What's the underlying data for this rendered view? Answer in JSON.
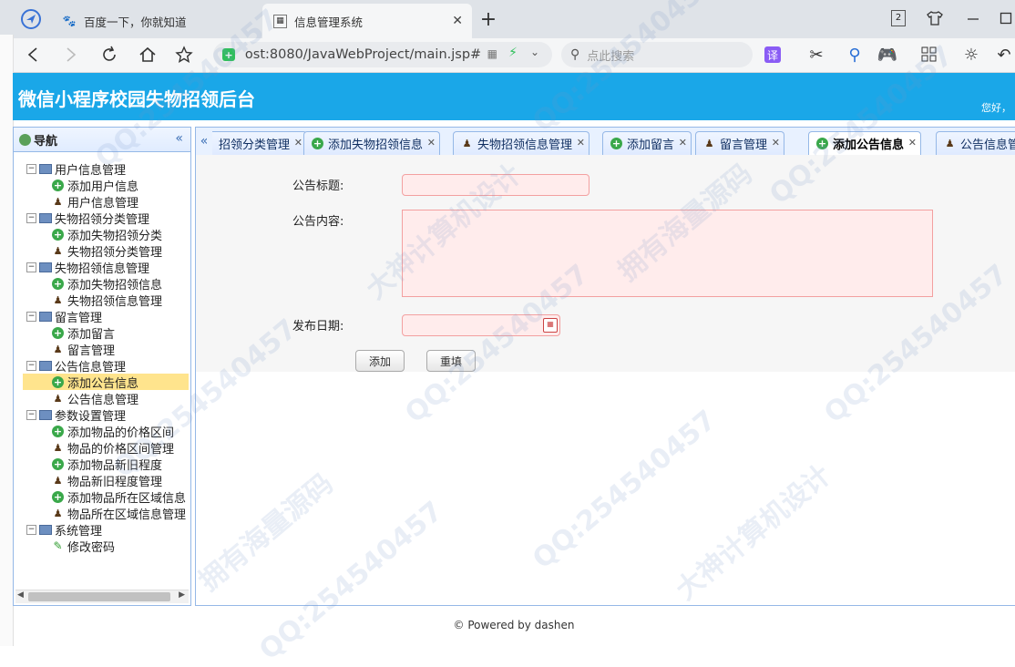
{
  "browser": {
    "tabs": [
      {
        "title": "百度一下，你就知道",
        "icon": "baidu-paw-icon"
      },
      {
        "title": "信息管理系统",
        "icon": "page-icon"
      }
    ],
    "new_tab": "+",
    "tab_counter": "2",
    "url": " ost:8080/JavaWebProject/main.jsp#",
    "search_placeholder": "点此搜索",
    "translate_label": "译"
  },
  "app": {
    "title": "微信小程序校园失物招领后台",
    "greeting": "您好，"
  },
  "nav": {
    "header": "导航",
    "groups": [
      {
        "label": "用户信息管理",
        "items": [
          {
            "label": "添加用户信息",
            "icon": "add-icon"
          },
          {
            "label": "用户信息管理",
            "icon": "user-icon"
          }
        ]
      },
      {
        "label": "失物招领分类管理",
        "items": [
          {
            "label": "添加失物招领分类",
            "icon": "add-icon"
          },
          {
            "label": "失物招领分类管理",
            "icon": "user-icon"
          }
        ]
      },
      {
        "label": "失物招领信息管理",
        "items": [
          {
            "label": "添加失物招领信息",
            "icon": "add-icon"
          },
          {
            "label": "失物招领信息管理",
            "icon": "user-icon"
          }
        ]
      },
      {
        "label": "留言管理",
        "items": [
          {
            "label": "添加留言",
            "icon": "add-icon"
          },
          {
            "label": "留言管理",
            "icon": "user-icon"
          }
        ]
      },
      {
        "label": "公告信息管理",
        "items": [
          {
            "label": "添加公告信息",
            "icon": "add-icon",
            "selected": true
          },
          {
            "label": "公告信息管理",
            "icon": "user-icon"
          }
        ]
      },
      {
        "label": "参数设置管理",
        "items": [
          {
            "label": "添加物品的价格区间",
            "icon": "add-icon"
          },
          {
            "label": "物品的价格区间管理",
            "icon": "user-icon"
          },
          {
            "label": "添加物品新旧程度",
            "icon": "add-icon"
          },
          {
            "label": "物品新旧程度管理",
            "icon": "user-icon"
          },
          {
            "label": "添加物品所在区域信息",
            "icon": "add-icon"
          },
          {
            "label": "物品所在区域信息管理",
            "icon": "user-icon"
          }
        ]
      },
      {
        "label": "系统管理",
        "items": [
          {
            "label": "修改密码",
            "icon": "pencil-icon"
          }
        ]
      }
    ]
  },
  "tabs": [
    {
      "label": "招领分类管理",
      "icon": "none"
    },
    {
      "label": "添加失物招领信息",
      "icon": "add-icon"
    },
    {
      "label": "失物招领信息管理",
      "icon": "user-icon"
    },
    {
      "label": "添加留言",
      "icon": "add-icon"
    },
    {
      "label": "留言管理",
      "icon": "user-icon"
    },
    {
      "label": "添加公告信息",
      "icon": "add-icon",
      "active": true
    },
    {
      "label": "公告信息管理",
      "icon": "user-icon"
    }
  ],
  "form": {
    "title_label": "公告标题:",
    "content_label": "公告内容:",
    "date_label": "发布日期:",
    "title_value": "",
    "content_value": "",
    "date_value": "",
    "add_button": "添加",
    "reset_button": "重填"
  },
  "footer": "© Powered by dashen",
  "watermarks": [
    "QQ:254540457",
    "大神计算机设计",
    "拥有海量源码"
  ]
}
